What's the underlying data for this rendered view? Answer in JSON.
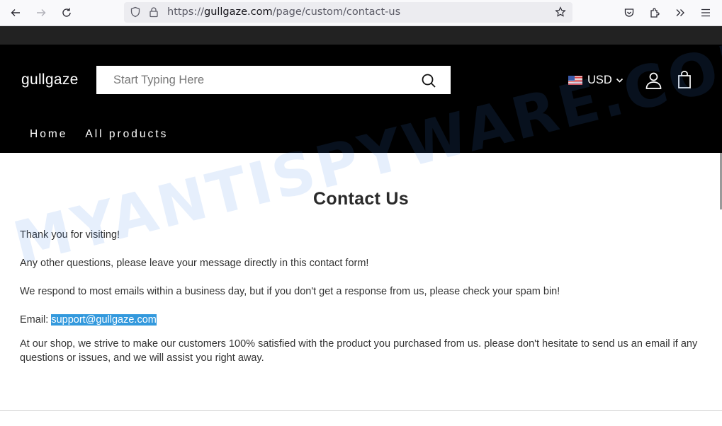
{
  "browser": {
    "url_scheme": "https://",
    "url_host": "gullgaze.com",
    "url_path": "/page/custom/contact-us",
    "icons": [
      "back-icon",
      "forward-icon",
      "reload-icon",
      "shield-icon",
      "lock-icon",
      "bookmark-star-icon",
      "pocket-icon",
      "extensions-icon",
      "overflow-icon",
      "menu-icon"
    ]
  },
  "header": {
    "logo": "gullgaze",
    "search_placeholder": "Start Typing Here",
    "currency": "USD",
    "nav": [
      {
        "label": "Home"
      },
      {
        "label": "All products"
      }
    ]
  },
  "main": {
    "title": "Contact Us",
    "paragraphs": [
      "Thank you for visiting!",
      "Any other questions, please leave your message directly in this contact form!",
      "We respond to most emails within a business day, but if you don't get a response from us, please check your spam bin!"
    ],
    "email_label": "Email: ",
    "email": "support@gullgaze.com",
    "closing": "At our shop, we strive to make our customers 100% satisfied with the product you purchased from us. please don't hesitate to send us an email if any questions or issues, and we will assist you right away."
  },
  "watermark": "MYANTISPYWARE.COM",
  "colors": {
    "header_bg": "#000000",
    "announce_bg": "#222222",
    "email_highlight": "#3399dd"
  }
}
